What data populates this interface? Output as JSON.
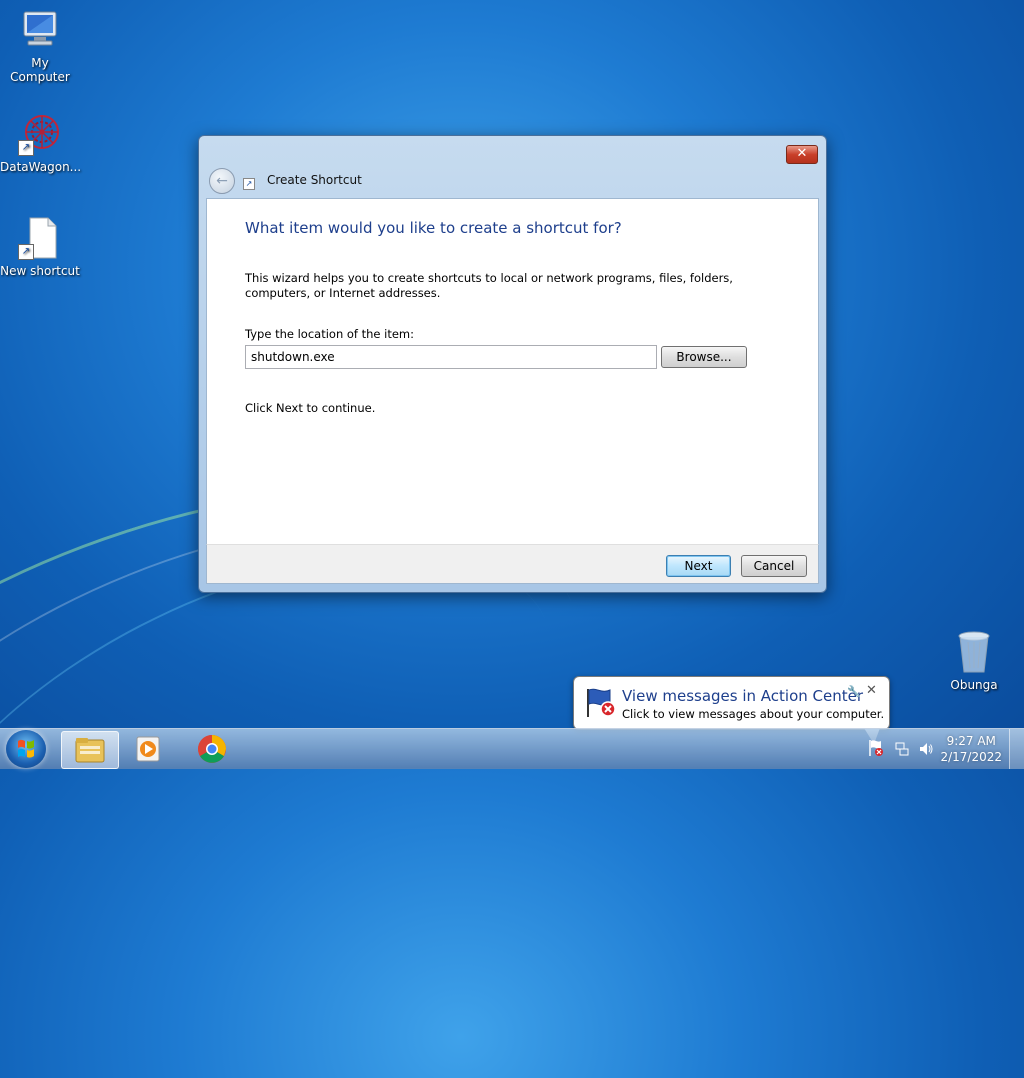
{
  "desktop": {
    "icons": [
      {
        "label": "My Computer",
        "icon": "computer-icon"
      },
      {
        "label": "DataWagon...",
        "icon": "datawagon-icon"
      },
      {
        "label": "New shortcut",
        "icon": "file-shortcut-icon"
      },
      {
        "label": "Obunga",
        "icon": "recycle-bin-icon"
      }
    ]
  },
  "dialog": {
    "title": "Create Shortcut",
    "close_label": "✕",
    "heading": "What item would you like to create a shortcut for?",
    "description": "This wizard helps you to create shortcuts to local or network programs, files, folders, computers, or Internet addresses.",
    "location_label": "Type the location of the item:",
    "location_value": "shutdown.exe",
    "browse_label": "Browse...",
    "continue_text": "Click Next to continue.",
    "next_label": "Next",
    "cancel_label": "Cancel"
  },
  "notification": {
    "title": "View messages in Action Center",
    "subtitle": "Click to view messages about your computer."
  },
  "taskbar": {
    "time": "9:27 AM",
    "date": "2/17/2022",
    "pinned": [
      "file-explorer-icon",
      "media-player-icon",
      "chrome-icon"
    ]
  },
  "colors": {
    "heading": "#1e3f8c",
    "desktop": "#1e7bd2"
  }
}
